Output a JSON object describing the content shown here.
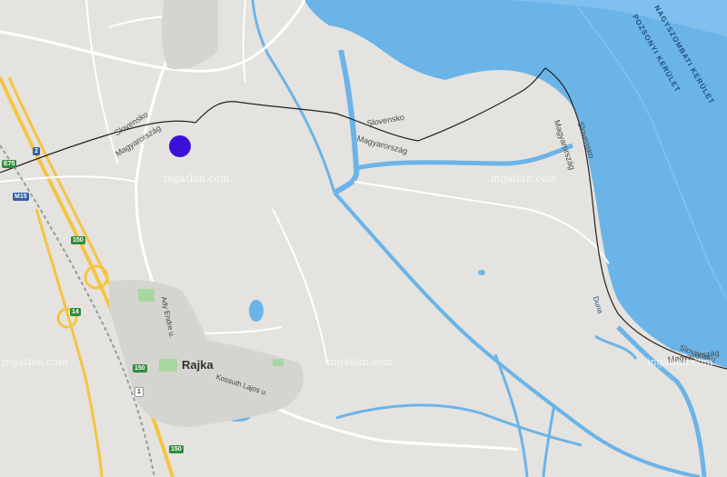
{
  "map": {
    "town": "Rajka",
    "streets": [
      "Ady Endre u.",
      "Kossuth Lajos u."
    ],
    "river": "Duna",
    "border_labels": {
      "sk1": "Slovensko",
      "hu1": "Magyarország",
      "sk2": "Slovensko",
      "hu2": "Magyarország",
      "sk3": "Slovensko",
      "hu3": "Magyarország",
      "sk4": "Slovensko",
      "hu4": "Magyarország"
    },
    "district_labels": [
      "NAGYSZOMBATI KERÜLET",
      "POZSONYI KERÜLET"
    ],
    "road_shields": {
      "r2": "2",
      "e75": "E75",
      "m15": "M15",
      "r150a": "150",
      "r14": "14",
      "r150b": "150",
      "r150c": "150",
      "r1": "1"
    },
    "watermark": "ingatlan.com",
    "marker_color": "#3b10d8",
    "water_color": "#6bb4e8",
    "land_color": "#e5e3df"
  }
}
